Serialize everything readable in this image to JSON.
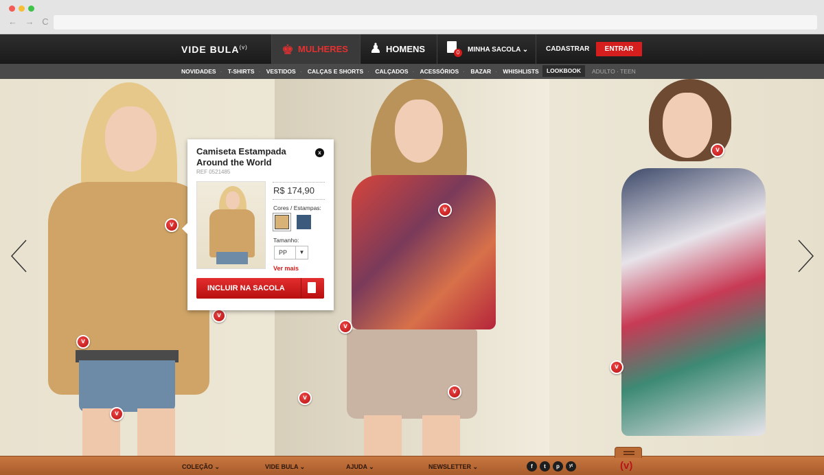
{
  "browser": {
    "nav_glyphs": "← → C"
  },
  "header": {
    "logo": "VIDE BULA",
    "logo_sup": "(v)",
    "women_label": "MULHERES",
    "men_label": "HOMENS",
    "bag_label": "MINHA SACOLA ⌄",
    "bag_count": "0",
    "register_label": "CADASTRAR",
    "login_label": "ENTRAR"
  },
  "subnav": {
    "items": [
      "NOVIDADES",
      "T-SHIRTS",
      "VESTIDOS",
      "CALÇAS E SHORTS",
      "CALÇADOS",
      "ACESSÓRIOS",
      "BAZAR",
      "WHISHLISTS"
    ],
    "separator": "·",
    "lookbook": "LOOKBOOK",
    "adult_teen": "ADULTO · TEEN"
  },
  "popup": {
    "title": "Camiseta Estampada Around the World",
    "ref": "REF 0521485",
    "price": "R$ 174,90",
    "colors_label": "Cores / Estampas:",
    "size_label": "Tamanho:",
    "size_value": "PP",
    "size_caret": "▼",
    "see_more": "Ver mais",
    "add_to_bag": "INCLUIR NA SACOLA",
    "close": "x",
    "swatch_colors": [
      "#d9b277",
      "#3b5a7c"
    ]
  },
  "hotspot_glyph": "v",
  "carousel": {
    "prev_icon": "chevron-left",
    "next_icon": "chevron-right"
  },
  "footer": {
    "colecao": "COLEÇÃO ⌄",
    "vide_bula": "VIDE BULA ⌄",
    "ajuda": "AJUDA ⌄",
    "newsletter": "NEWSLETTER ⌄",
    "social": [
      "f",
      "t",
      "p",
      "yt"
    ],
    "logo": "(v)"
  },
  "colors": {
    "accent_red": "#d51e1e",
    "header_dark": "#1f1f1f",
    "footer_wood": "#b96a35"
  }
}
